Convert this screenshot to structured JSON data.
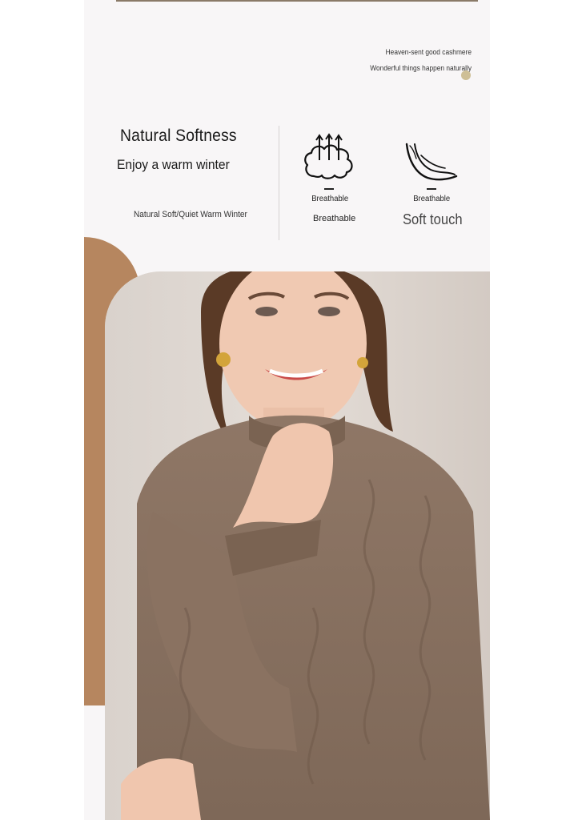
{
  "header": {
    "tagline_1": "Heaven-sent good cashmere",
    "tagline_2": "Wonderful things happen naturally"
  },
  "feature": {
    "title": "Natural Softness",
    "subtitle": "Enjoy a warm winter",
    "caption": "Natural Soft/Quiet Warm Winter"
  },
  "icons": [
    {
      "name": "cloud-arrows-icon",
      "label": "Breathable",
      "caption": "Breathable"
    },
    {
      "name": "feather-icon",
      "label": "Breathable",
      "caption": "Soft touch"
    }
  ],
  "colors": {
    "accent_brown": "#b6865f",
    "panel_bg": "#f8f6f7",
    "sweater": "#8c7462"
  }
}
